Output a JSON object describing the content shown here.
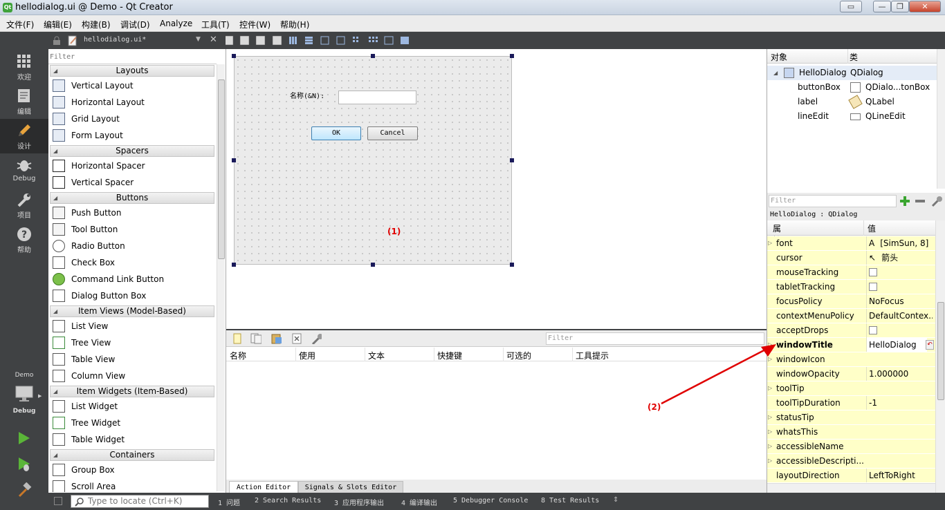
{
  "window": {
    "title": "hellodialog.ui @ Demo - Qt Creator",
    "app_icon_label": "Qt",
    "btn_extra": "▭",
    "btn_minimize": "—",
    "btn_maximize": "❐",
    "btn_close": "✕"
  },
  "menu": [
    "文件(F)",
    "编辑(E)",
    "构建(B)",
    "调试(D)",
    "Analyze",
    "工具(T)",
    "控件(W)",
    "帮助(H)"
  ],
  "modes": [
    {
      "label": "欢迎",
      "icon": "grid-icon"
    },
    {
      "label": "编辑",
      "icon": "edit-document-icon"
    },
    {
      "label": "设计",
      "icon": "pencil-icon",
      "active": true
    },
    {
      "label": "Debug",
      "icon": "bug-icon"
    },
    {
      "label": "项目",
      "icon": "wrench-icon"
    },
    {
      "label": "帮助",
      "icon": "help-icon"
    }
  ],
  "kit": {
    "project": "Demo",
    "config": "Debug"
  },
  "editor": {
    "file_tab": "hellodialog.ui*",
    "close": "✕"
  },
  "widgetbox": {
    "filter_placeholder": "Filter",
    "categories": {
      "layouts": "Layouts",
      "spacers": "Spacers",
      "buttons": "Buttons",
      "item_views": "Item Views (Model-Based)",
      "item_widgets": "Item Widgets (Item-Based)",
      "containers": "Containers"
    },
    "items": {
      "vertical_layout": "Vertical Layout",
      "horizontal_layout": "Horizontal Layout",
      "grid_layout": "Grid Layout",
      "form_layout": "Form Layout",
      "horizontal_spacer": "Horizontal Spacer",
      "vertical_spacer": "Vertical Spacer",
      "push_button": "Push Button",
      "tool_button": "Tool Button",
      "radio_button": "Radio Button",
      "check_box": "Check Box",
      "command_link_button": "Command Link Button",
      "dialog_button_box": "Dialog Button Box",
      "list_view": "List View",
      "tree_view": "Tree View",
      "table_view": "Table View",
      "column_view": "Column View",
      "list_widget": "List Widget",
      "tree_widget": "Tree Widget",
      "table_widget": "Table Widget",
      "group_box": "Group Box",
      "scroll_area": "Scroll Area"
    }
  },
  "form": {
    "label": "名称(&N):",
    "ok": "OK",
    "cancel": "Cancel",
    "annotation_1": "(1)",
    "annotation_2": "(2)"
  },
  "action_editor": {
    "filter_placeholder": "Filter",
    "columns": [
      "名称",
      "使用",
      "文本",
      "快捷键",
      "可选的",
      "工具提示"
    ],
    "tabs": [
      "Action Editor",
      "Signals & Slots Editor"
    ]
  },
  "object_inspector": {
    "headers": [
      "对象",
      "类"
    ],
    "rows": [
      {
        "object": "HelloDialog",
        "class": "QDialog"
      },
      {
        "object": "buttonBox",
        "class": "QDialo...tonBox"
      },
      {
        "object": "label",
        "class": "QLabel"
      },
      {
        "object": "lineEdit",
        "class": "QLineEdit"
      }
    ]
  },
  "property_editor": {
    "filter_placeholder": "Filter",
    "class_label": "HelloDialog : QDialog",
    "headers": [
      "属性",
      "值"
    ],
    "properties": [
      {
        "name": "font",
        "value": "[SimSun, 8]",
        "icon": "font-a-icon"
      },
      {
        "name": "cursor",
        "value": "箭头",
        "icon": "arrow-cursor-icon"
      },
      {
        "name": "mouseTracking",
        "value": "",
        "checkbox": true
      },
      {
        "name": "tabletTracking",
        "value": "",
        "checkbox": true
      },
      {
        "name": "focusPolicy",
        "value": "NoFocus"
      },
      {
        "name": "contextMenuPolicy",
        "value": "DefaultContex..."
      },
      {
        "name": "acceptDrops",
        "value": "",
        "checkbox": true
      },
      {
        "name": "windowTitle",
        "value": "HelloDialog",
        "bold": true
      },
      {
        "name": "windowIcon",
        "value": ""
      },
      {
        "name": "windowOpacity",
        "value": "1.000000"
      },
      {
        "name": "toolTip",
        "value": ""
      },
      {
        "name": "toolTipDuration",
        "value": "-1"
      },
      {
        "name": "statusTip",
        "value": ""
      },
      {
        "name": "whatsThis",
        "value": ""
      },
      {
        "name": "accessibleName",
        "value": ""
      },
      {
        "name": "accessibleDescripti...",
        "value": ""
      },
      {
        "name": "layoutDirection",
        "value": "LeftToRight"
      }
    ]
  },
  "statusbar": {
    "locate_placeholder": "Type to locate (Ctrl+K)",
    "panes": [
      "1 问题",
      "2 Search Results",
      "3 应用程序输出",
      "4 编译输出",
      "5 Debugger Console",
      "8 Test Results"
    ]
  },
  "colors": {
    "annotation": "#e00000",
    "dark_chrome": "#404244",
    "property_bg": "#ffffc8"
  }
}
